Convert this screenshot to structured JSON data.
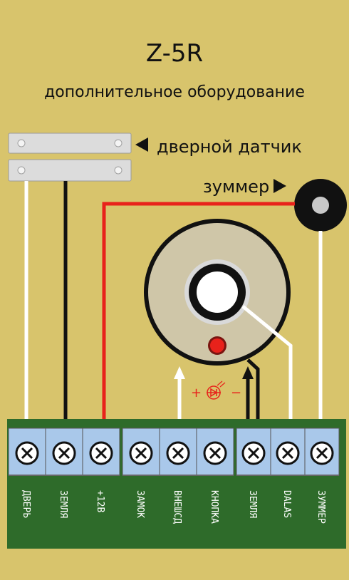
{
  "title": "Z-5R",
  "subtitle": "дополнительное оборудование",
  "door_sensor_label": "дверной датчик",
  "buzzer_label": "зуммер",
  "led_plus": "+",
  "led_minus": "−",
  "colors": {
    "background": "#d8c46c",
    "board": "#2e6b2a",
    "terminal_block": "#a9c8ea",
    "red_wire": "#e8221b",
    "white_wire": "#ffffff",
    "black_wire": "#111111",
    "reader_ring": "#cfc6a8"
  },
  "terminals": [
    "ДВЕРЬ",
    "ЗЕМЛЯ",
    "+12В",
    "ЗАМОК",
    "ВНЕШСД",
    "КНОПКА",
    "ЗЕМЛЯ",
    "DALAS",
    "ЗУММЕР"
  ]
}
